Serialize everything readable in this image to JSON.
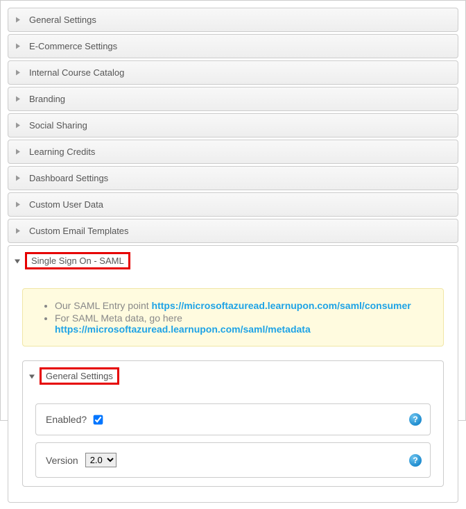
{
  "accordion": {
    "collapsed": [
      "General Settings",
      "E-Commerce Settings",
      "Internal Course Catalog",
      "Branding",
      "Social Sharing",
      "Learning Credits",
      "Dashboard Settings",
      "Custom User Data",
      "Custom Email Templates"
    ],
    "expanded": {
      "title": "Single Sign On - SAML",
      "note": {
        "line1_prefix": "Our SAML Entry point ",
        "line1_link": "https://microsoftazuread.learnupon.com/saml/consumer",
        "line2_prefix": "For SAML Meta data, go here ",
        "line2_link": "https://microsoftazuread.learnupon.com/saml/metadata"
      },
      "inner": {
        "title": "General Settings",
        "fields": {
          "enabled_label": "Enabled?",
          "enabled_checked": true,
          "version_label": "Version",
          "version_value": "2.0"
        },
        "help_glyph": "?"
      }
    }
  }
}
